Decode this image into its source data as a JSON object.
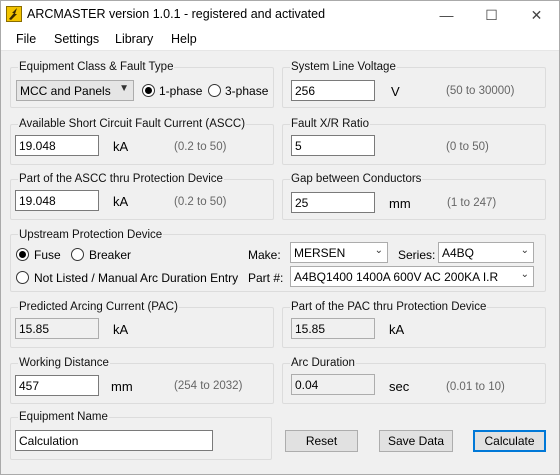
{
  "window": {
    "title": "ARCMASTER version 1.0.1 - registered and activated",
    "minimize": "—",
    "maximize": "☐",
    "close": "✕"
  },
  "menu": [
    "File",
    "Settings",
    "Library",
    "Help"
  ],
  "equipment_class": {
    "group_label": "Equipment Class & Fault Type",
    "selected": "MCC and Panels",
    "phase_1_label": "1-phase",
    "phase_3_label": "3-phase",
    "phase_selected": "1-phase"
  },
  "line_voltage": {
    "group_label": "System Line Voltage",
    "value": "256",
    "unit": "V",
    "range": "(50 to 30000)"
  },
  "ascc": {
    "group_label": "Available Short Circuit Fault Current (ASCC)",
    "value": "19.048",
    "unit": "kA",
    "range": "(0.2 to 50)"
  },
  "xr_ratio": {
    "group_label": "Fault X/R Ratio",
    "value": "5",
    "range": "(0 to 50)"
  },
  "ascc_thru": {
    "group_label": "Part of the ASCC thru Protection Device",
    "value": "19.048",
    "unit": "kA",
    "range": "(0.2 to 50)"
  },
  "gap": {
    "group_label": "Gap between Conductors",
    "value": "25",
    "unit": "mm",
    "range": "(1 to 247)"
  },
  "upstream": {
    "group_label": "Upstream Protection Device",
    "fuse_label": "Fuse",
    "breaker_label": "Breaker",
    "not_listed_label": "Not Listed / Manual Arc Duration Entry",
    "selected": "Fuse",
    "make_label": "Make:",
    "make_value": "MERSEN",
    "series_label": "Series:",
    "series_value": "A4BQ",
    "part_label": "Part #:",
    "part_value": "A4BQ1400 1400A 600V AC 200KA I.R"
  },
  "pac": {
    "group_label": "Predicted Arcing Current (PAC)",
    "value": "15.85",
    "unit": "kA"
  },
  "pac_thru": {
    "group_label": "Part of the PAC thru Protection Device",
    "value": "15.85",
    "unit": "kA"
  },
  "working_distance": {
    "group_label": "Working Distance",
    "value": "457",
    "unit": "mm",
    "range": "(254 to 2032)"
  },
  "arc_duration": {
    "group_label": "Arc Duration",
    "value": "0.04",
    "unit": "sec",
    "range": "(0.01 to 10)"
  },
  "equipment_name": {
    "group_label": "Equipment Name",
    "value": "Calculation"
  },
  "buttons": {
    "reset": "Reset",
    "save": "Save Data",
    "calculate": "Calculate"
  },
  "colors": {
    "app_icon": "#f3c400",
    "default_button_border": "#0078d7"
  }
}
